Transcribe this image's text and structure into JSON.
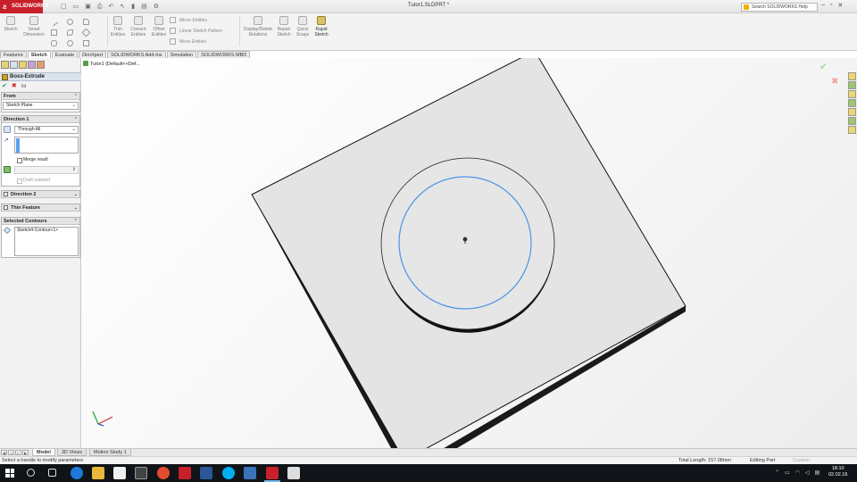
{
  "app": {
    "logo_text": "SOLIDWORKS",
    "document_title": "Tutor1.SLDPRT *",
    "help_search_placeholder": "Search SOLIDWORKS Help",
    "brand_color": "#c8202a"
  },
  "ribbon": {
    "sketch_label": "Sketch",
    "smart_dimension_label": "Smart Dimension",
    "trim_entities_label": "Trim Entities",
    "convert_entities_label": "Convert Entities",
    "offset_entities_label": "Offset Entities",
    "mirror_entities_label": "Mirror Entities",
    "linear_pattern_label": "Linear Sketch Pattern",
    "move_entities_label": "Move Entities",
    "display_delete_label": "Display/Delete Relations",
    "repair_sketch_label": "Repair Sketch",
    "quick_snaps_label": "Quick Snaps",
    "rapid_sketch_label": "Rapid Sketch"
  },
  "tabs": [
    {
      "label": "Features"
    },
    {
      "label": "Sketch"
    },
    {
      "label": "Evaluate"
    },
    {
      "label": "DimXpert"
    },
    {
      "label": "SOLIDWORKS Add-Ins"
    },
    {
      "label": "Simulation"
    },
    {
      "label": "SOLIDWORKS MBD"
    }
  ],
  "property_manager": {
    "title": "Boss-Extrude",
    "ok_glyph": "✔",
    "cancel_glyph": "✖",
    "preview_glyph": "6d",
    "from": {
      "header": "From",
      "selected": "Sketch Plane"
    },
    "direction1": {
      "header": "Direction 1",
      "end_condition": "Through All",
      "merge_result_label": "Merge result",
      "draft_outward_label": "Draft outward"
    },
    "direction2": {
      "header": "Direction 2"
    },
    "thin_feature": {
      "header": "Thin Feature"
    },
    "selected_contours": {
      "header": "Selected Contours",
      "item": "Sketch4-Contour<1>"
    }
  },
  "graphics": {
    "tree_flyout_text": "Tutor1  (Default<<Def..."
  },
  "bottom_tabs": [
    {
      "label": "Model"
    },
    {
      "label": "3D Views"
    },
    {
      "label": "Motion Study 1"
    }
  ],
  "status": {
    "message": "Select a handle to modify parameters",
    "total_length": "Total Length: 157.08mm",
    "mode": "Editing Part",
    "units": "Custom"
  },
  "taskbar": {
    "time": "18:10",
    "date": "02.02.16"
  }
}
